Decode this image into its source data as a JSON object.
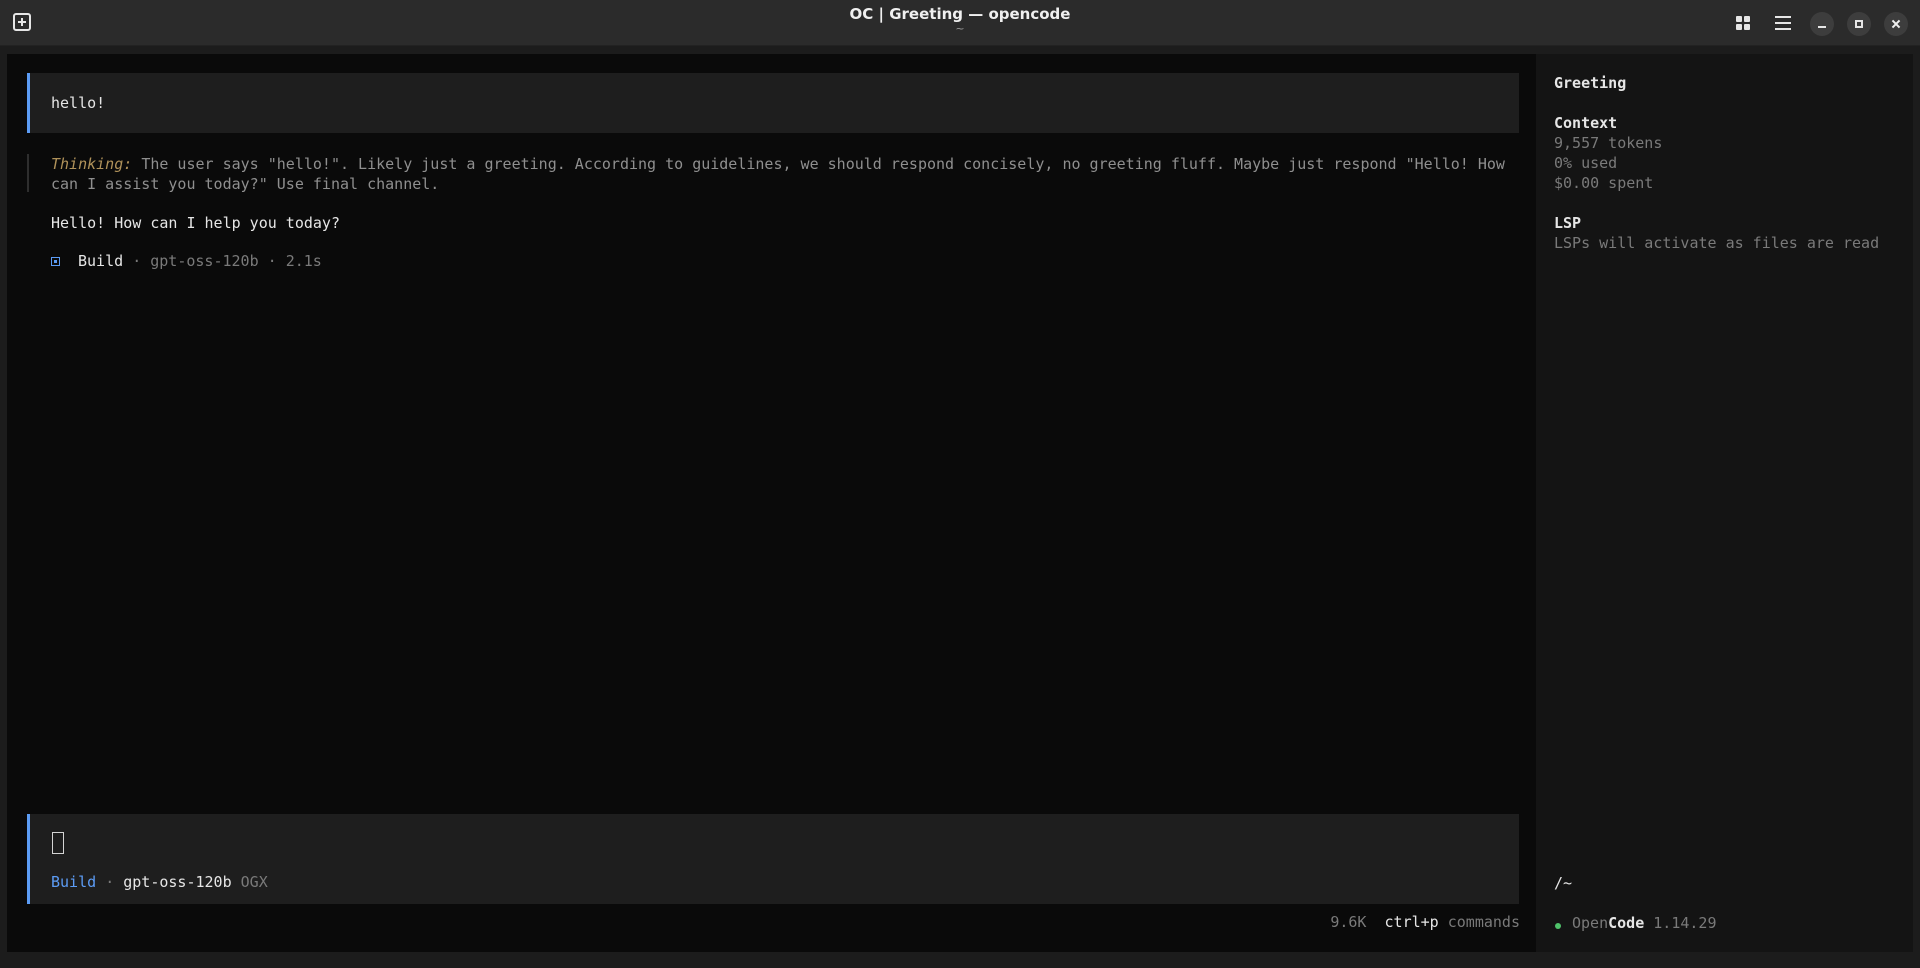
{
  "window": {
    "title": "OC | Greeting — opencode",
    "subtitle": "~"
  },
  "conversation": {
    "user_message": "hello!",
    "thinking_label": "Thinking:",
    "thinking_text": "The user says \"hello!\". Likely just a greeting. According to guidelines, we should respond concisely, no greeting fluff. Maybe just respond \"Hello! How can I assist you today?\" Use final channel.",
    "assistant_reply": "Hello! How can I help you today?",
    "meta": {
      "agent": "Build",
      "model": "gpt-oss-120b",
      "duration": "2.1s",
      "separator": "·"
    }
  },
  "input": {
    "agent": "Build",
    "separator": "·",
    "model": "gpt-oss-120b",
    "provider": "OGX"
  },
  "footer": {
    "tokens": "9.6K",
    "shortcut": "ctrl+p",
    "shortcut_label": "commands"
  },
  "sidebar": {
    "session_title": "Greeting",
    "context_heading": "Context",
    "tokens": "9,557 tokens",
    "used": "0% used",
    "spent": "$0.00 spent",
    "lsp_heading": "LSP",
    "lsp_text": "LSPs will activate as files are read",
    "cwd": "/~",
    "app_name_prefix": "Open",
    "app_name_suffix": "Code",
    "version": "1.14.29"
  }
}
